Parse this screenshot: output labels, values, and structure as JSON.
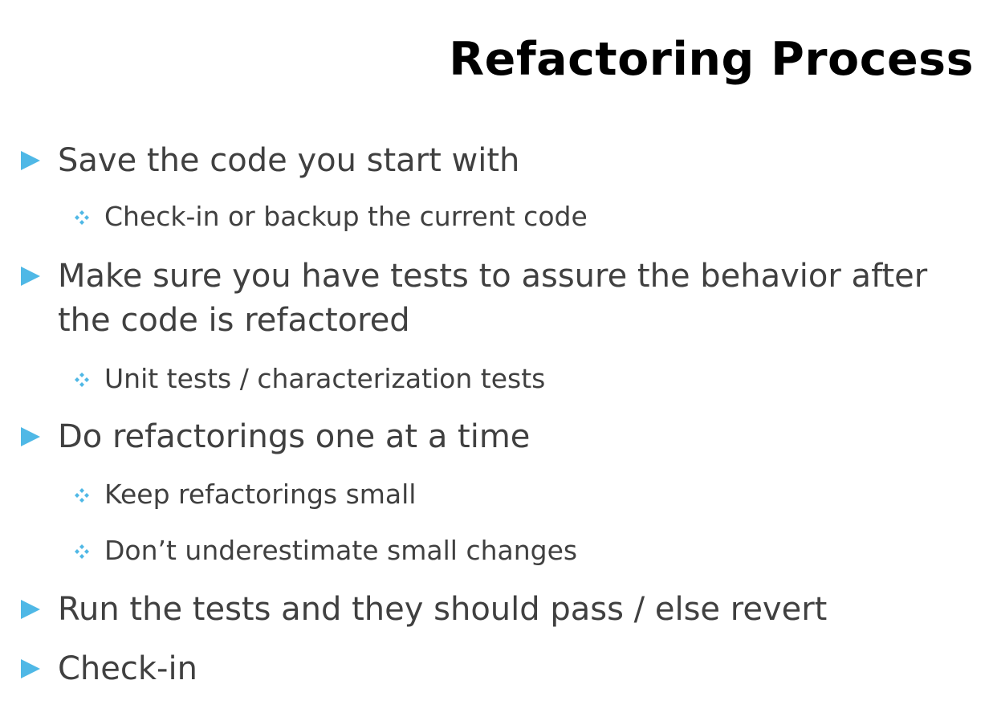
{
  "slide": {
    "title": "Refactoring Process",
    "accent_color": "#4fb8e6",
    "text_color": "#404040",
    "bullets": [
      {
        "text": "Save the code you start with",
        "level": 1,
        "icon": "triangle-right-icon"
      },
      {
        "text": "Check-in or backup the current code",
        "level": 2,
        "icon": "four-diamond-icon"
      },
      {
        "text": "Make sure you have tests to assure the behavior after",
        "level": 1,
        "icon": "triangle-right-icon"
      },
      {
        "text": "the code is refactored",
        "level": 1,
        "continuation": true
      },
      {
        "text": "Unit tests / characterization tests",
        "level": 2,
        "icon": "four-diamond-icon"
      },
      {
        "text": "Do refactorings one at a time",
        "level": 1,
        "icon": "triangle-right-icon"
      },
      {
        "text": "Keep refactorings small",
        "level": 2,
        "icon": "four-diamond-icon"
      },
      {
        "text": "Don’t underestimate small changes",
        "level": 2,
        "icon": "four-diamond-icon"
      },
      {
        "text": "Run the tests and they should pass / else revert",
        "level": 1,
        "icon": "triangle-right-icon"
      },
      {
        "text": "Check-in",
        "level": 1,
        "icon": "triangle-right-icon"
      }
    ]
  }
}
